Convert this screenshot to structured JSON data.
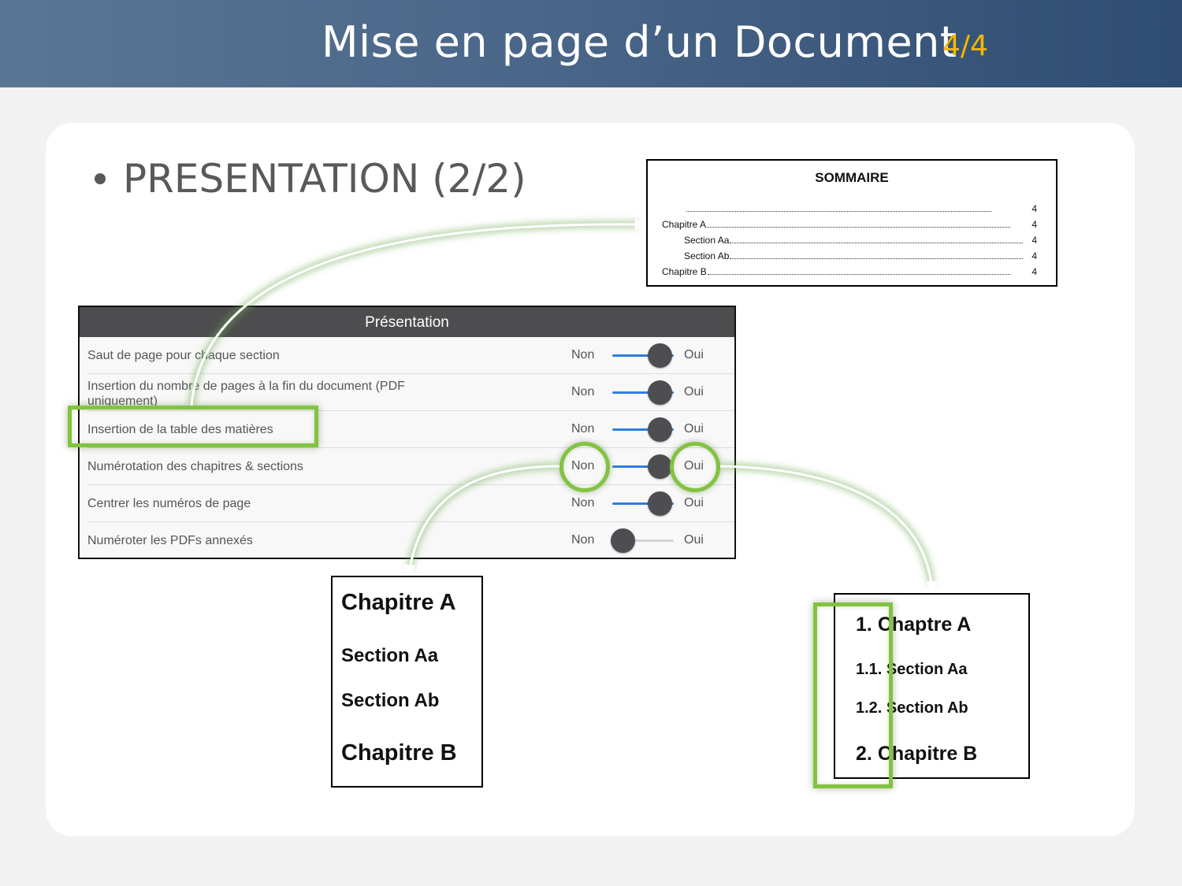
{
  "banner": {
    "title": "Mise en page d’un Document",
    "page_counter": "4/4"
  },
  "slide": {
    "heading": "PRESENTATION (2/2)"
  },
  "toc_preview": {
    "title": "SOMMAIRE",
    "entries": [
      {
        "label": "",
        "page": "4"
      },
      {
        "label": "Chapitre A",
        "page": "4"
      },
      {
        "label": "Section Aa",
        "page": "4"
      },
      {
        "label": "Section Ab",
        "page": "4"
      },
      {
        "label": "Chapitre B",
        "page": "4"
      }
    ]
  },
  "panel": {
    "title": "Présentation",
    "off_label": "Non",
    "on_label": "Oui",
    "options": [
      {
        "label": "Saut de page pour chaque section",
        "enabled": true
      },
      {
        "label": "Insertion du nombre de pages à la fin du document (PDF uniquement)",
        "enabled": true
      },
      {
        "label": "Insertion de la table des matières",
        "enabled": true
      },
      {
        "label": "Numérotation des chapitres & sections",
        "enabled": true
      },
      {
        "label": "Centrer les numéros de page",
        "enabled": true
      },
      {
        "label": "Numéroter les PDFs annexés",
        "enabled": false
      }
    ]
  },
  "plain_headings": [
    "Chapitre A",
    "Section Aa",
    "Section Ab",
    "Chapitre B"
  ],
  "numbered_headings": [
    {
      "number": "1.",
      "text": "Chaptre A"
    },
    {
      "number": "1.1.",
      "text": "Section Aa"
    },
    {
      "number": "1.2.",
      "text": "Section Ab"
    },
    {
      "number": "2.",
      "text": "Chapitre B"
    }
  ],
  "colors": {
    "highlight": "#82c341",
    "toggle_on": "#2f7de1",
    "page_counter": "#f5b800"
  }
}
